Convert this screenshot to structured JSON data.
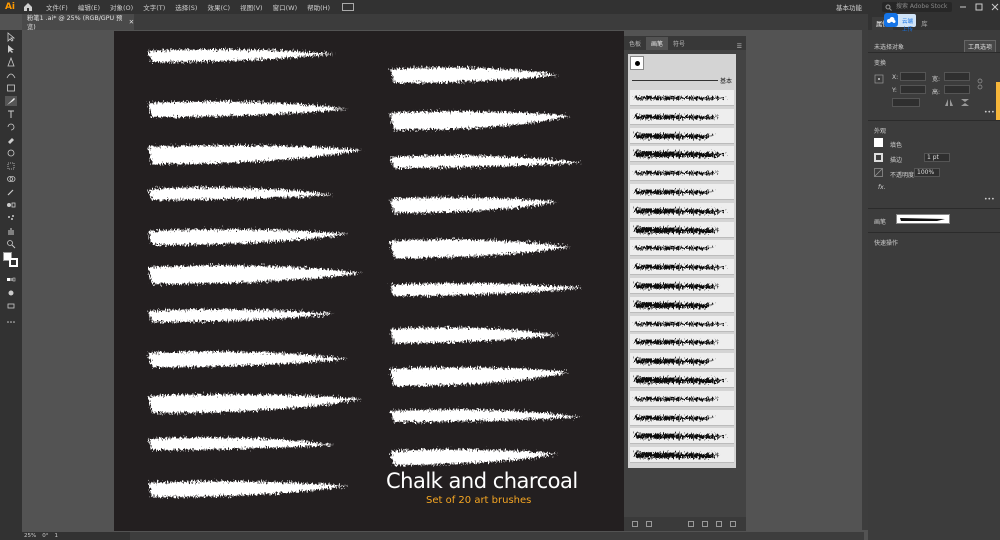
{
  "app": {
    "logo": "Ai",
    "workspace": "基本功能",
    "search_placeholder": "搜索 Adobe Stock"
  },
  "menu": [
    "文件(F)",
    "编辑(E)",
    "对象(O)",
    "文字(T)",
    "选择(S)",
    "效果(C)",
    "视图(V)",
    "窗口(W)",
    "帮助(H)"
  ],
  "document_tab": {
    "title": "粉笔1 .ai* @ 25% (RGB/GPU 预览)"
  },
  "artwork": {
    "title": "Chalk and charcoal",
    "subtitle": "Set of 20 art brushes"
  },
  "colors": {
    "accent": "#f5a623",
    "artboard": "#231f20",
    "panel": "#434343",
    "cloud_blue": "#1473e6"
  },
  "brushes_panel": {
    "tabs": [
      "色板",
      "画笔",
      "符号"
    ],
    "active_tab": "画笔",
    "basic_label": "基本",
    "brush_count": 20
  },
  "properties_panel": {
    "tabs": [
      "属性",
      "图层",
      "库"
    ],
    "cloud_label": "云端上传",
    "no_selection": "未选择对象",
    "tool_options": "工具选项",
    "transform": "变换",
    "x_label": "X:",
    "y_label": "Y:",
    "w_label": "宽:",
    "h_label": "高:",
    "appearance": "外观",
    "fill": "填色",
    "stroke": "描边",
    "stroke_value": "1 pt",
    "opacity": "不透明度",
    "opacity_value": "100%",
    "fx": "fx.",
    "brush_label": "画笔",
    "quick_actions": "快速操作"
  },
  "status": {
    "zoom": "25%",
    "rotation": "0°",
    "artboard_num": "1"
  }
}
